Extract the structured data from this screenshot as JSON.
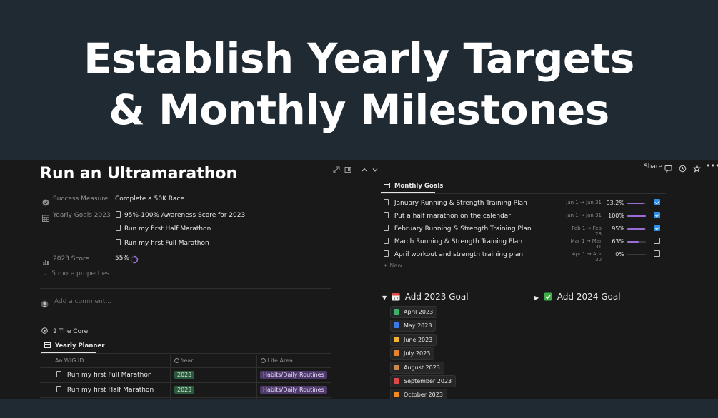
{
  "banner": {
    "line1": "Establish Yearly Targets",
    "line2": "& Monthly Milestones"
  },
  "page": {
    "title": "Run an Ultramarathon"
  },
  "topbar": {
    "share_label": "Share"
  },
  "properties": {
    "success_measure": {
      "name": "Success Measure",
      "value": "Complete a 50K Race"
    },
    "yearly_goals": {
      "name": "Yearly Goals 2023",
      "items": [
        "95%-100% Awareness Score for 2023",
        "Run my first Half Marathon",
        "Run my first Full Marathon"
      ]
    },
    "score": {
      "name": "2023 Score",
      "value": "55%",
      "fraction": 0.55
    },
    "more_label": "5 more properties"
  },
  "comment": {
    "placeholder": "Add a comment..."
  },
  "core": {
    "label": "2 The Core"
  },
  "yearly_planner": {
    "tab_label": "Yearly Planner",
    "columns": [
      "WIG ID",
      "Year",
      "Life Area"
    ],
    "col_prefix": "Aa",
    "rows": [
      {
        "name": "Run my first Full Marathon",
        "year": "2023",
        "area": "Habits/Daily Routines"
      },
      {
        "name": "Run my first Half Marathon",
        "year": "2023",
        "area": "Habits/Daily Routines"
      }
    ]
  },
  "monthly_goals": {
    "tab_label": "Monthly Goals",
    "rows": [
      {
        "name": "January Running & Strength Training Plan",
        "dates": "Jan 1 → Jan 31",
        "pct": "93.2%",
        "progress": 0.932,
        "done": true
      },
      {
        "name": "Put a half marathon on the calendar",
        "dates": "Jan 1 → Jan 31",
        "pct": "100%",
        "progress": 1.0,
        "done": true
      },
      {
        "name": "February Running & Strength Training Plan",
        "dates": "Feb 1 → Feb 28",
        "pct": "95%",
        "progress": 0.95,
        "done": true
      },
      {
        "name": "March Running & Strength Training Plan",
        "dates": "Mar 1 → Mar 31",
        "pct": "63%",
        "progress": 0.63,
        "done": false
      },
      {
        "name": "April workout and strength training plan",
        "dates": "Apr 1 → Apr 30",
        "pct": "0%",
        "progress": 0.0,
        "done": false
      }
    ],
    "new_label": "New"
  },
  "goal_2023": {
    "label": "Add 2023 Goal",
    "months": [
      {
        "label": "April 2023",
        "icon_color": "#3bb36b"
      },
      {
        "label": "May 2023",
        "icon_color": "#3b7be8"
      },
      {
        "label": "June 2023",
        "icon_color": "#f2b632"
      },
      {
        "label": "July 2023",
        "icon_color": "#e8832f"
      },
      {
        "label": "August 2023",
        "icon_color": "#c98a4a"
      },
      {
        "label": "September 2023",
        "icon_color": "#e04848"
      },
      {
        "label": "October 2023",
        "icon_color": "#f28b22"
      }
    ]
  },
  "goal_2024": {
    "label": "Add 2024 Goal"
  },
  "colors": {
    "banner_bg": "#1f2a33",
    "app_bg": "#191919",
    "accent_purple": "#9a6dd7",
    "checkbox_blue": "#2f8fe6",
    "year_tag": "#2b5a3d",
    "area_tag": "#4d3a6b"
  }
}
